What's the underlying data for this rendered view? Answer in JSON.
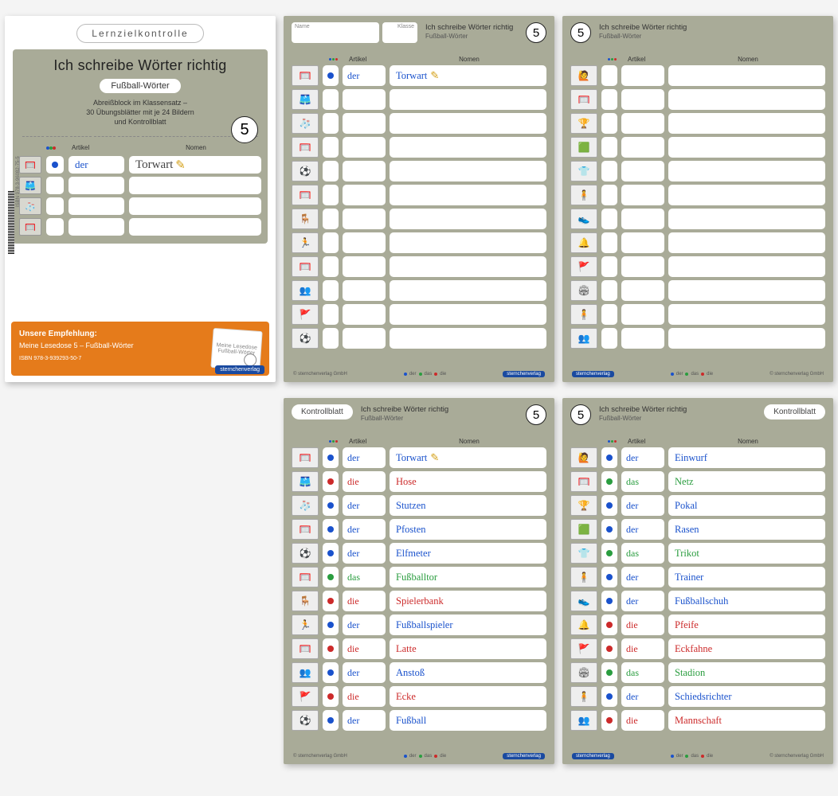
{
  "colors": {
    "der": "#1a52cc",
    "die": "#cc2a2a",
    "das": "#2a9d3f"
  },
  "cover": {
    "topLabel": "Lernzielkontrolle",
    "title": "Ich schreibe Wörter richtig",
    "subtitlePill": "Fußball-Wörter",
    "number": "5",
    "descLine1": "Abreißblock im Klassensatz –",
    "descLine2": "30 Übungsblätter mit je 24 Bildern",
    "descLine3": "und Kontrollblatt",
    "colHeaders": {
      "dots": "●●●",
      "artikel": "Artikel",
      "nomen": "Nomen"
    },
    "exampleRow": {
      "artikel": "der",
      "nomen": "Torwart"
    },
    "sideIsbn": "ISBN 978-3-96082-75-5",
    "reco": {
      "heading": "Unsere Empfehlung:",
      "text": "Meine Lesedose 5 – Fußball-Wörter",
      "isbn": "ISBN 978-3-939293-50-7",
      "thumbLabel": "Meine Lesedose",
      "thumbSub": "Fußball-Wörter"
    },
    "logo": "sternchenverlag"
  },
  "worksheet": {
    "title": "Ich schreibe Wörter richtig",
    "subtitle": "Fußball-Wörter",
    "number": "5",
    "nameLabel": "Name",
    "klasseLabel": "Klasse",
    "kontrollblatt": "Kontrollblatt",
    "colHeaders": {
      "artikel": "Artikel",
      "nomen": "Nomen"
    },
    "footerCopyright": "© sternchenverlag GmbH",
    "footerLegend": {
      "der": "der",
      "das": "das",
      "die": "die"
    },
    "footerLogo": "sternchenverlag"
  },
  "pageA": [
    {
      "icon": "🥅",
      "article": "der",
      "noun": "Torwart",
      "example": true
    },
    {
      "icon": "🩳",
      "article": "die",
      "noun": "Hose"
    },
    {
      "icon": "🧦",
      "article": "der",
      "noun": "Stutzen"
    },
    {
      "icon": "🥅",
      "article": "der",
      "noun": "Pfosten"
    },
    {
      "icon": "⚽",
      "article": "der",
      "noun": "Elfmeter"
    },
    {
      "icon": "🥅",
      "article": "das",
      "noun": "Fußballtor"
    },
    {
      "icon": "🪑",
      "article": "die",
      "noun": "Spielerbank"
    },
    {
      "icon": "🏃",
      "article": "der",
      "noun": "Fußballspieler"
    },
    {
      "icon": "🥅",
      "article": "die",
      "noun": "Latte"
    },
    {
      "icon": "👥",
      "article": "der",
      "noun": "Anstoß"
    },
    {
      "icon": "🚩",
      "article": "die",
      "noun": "Ecke"
    },
    {
      "icon": "⚽",
      "article": "der",
      "noun": "Fußball"
    }
  ],
  "pageB": [
    {
      "icon": "🙋",
      "article": "der",
      "noun": "Einwurf"
    },
    {
      "icon": "🥅",
      "article": "das",
      "noun": "Netz"
    },
    {
      "icon": "🏆",
      "article": "der",
      "noun": "Pokal"
    },
    {
      "icon": "🟩",
      "article": "der",
      "noun": "Rasen"
    },
    {
      "icon": "👕",
      "article": "das",
      "noun": "Trikot"
    },
    {
      "icon": "🧍",
      "article": "der",
      "noun": "Trainer"
    },
    {
      "icon": "👟",
      "article": "der",
      "noun": "Fußballschuh"
    },
    {
      "icon": "🔔",
      "article": "die",
      "noun": "Pfeife"
    },
    {
      "icon": "🚩",
      "article": "die",
      "noun": "Eckfahne"
    },
    {
      "icon": "🏟",
      "article": "das",
      "noun": "Stadion"
    },
    {
      "icon": "🧍",
      "article": "der",
      "noun": "Schiedsrichter"
    },
    {
      "icon": "👥",
      "article": "die",
      "noun": "Mannschaft"
    }
  ]
}
